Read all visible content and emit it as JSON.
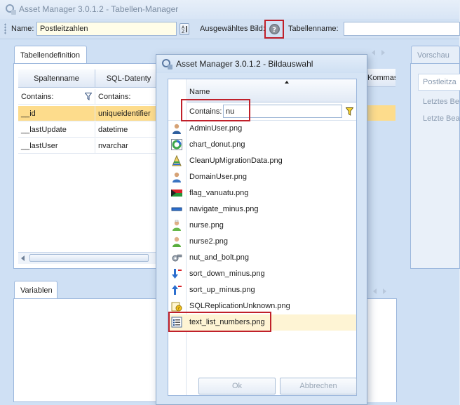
{
  "main": {
    "title": "Asset Manager 3.0.1.2 - Tabellen-Manager",
    "toolbar": {
      "name_label": "Name:",
      "name_value": "Postleitzahlen",
      "image_label": "Ausgewähltes Bild:",
      "tablename_label": "Tabellenname:",
      "tablename_value": ""
    },
    "table_def": {
      "tab": "Tabellendefinition",
      "columns": [
        "Spaltenname",
        "SQL-Datenty",
        "Kommas"
      ],
      "filter_label": "Contains:",
      "rows": [
        {
          "name": "__id",
          "type": "uniqueidentifier"
        },
        {
          "name": "__lastUpdate",
          "type": "datetime"
        },
        {
          "name": "__lastUser",
          "type": "nvarchar"
        }
      ]
    },
    "variables": {
      "tab": "Variablen"
    },
    "preview": {
      "tab": "Vorschau",
      "header": "Postleitza",
      "lines": [
        "Letztes Be",
        "Letzte Bea"
      ]
    }
  },
  "dialog": {
    "title": "Asset Manager 3.0.1.2 - Bildauswahl",
    "column": "Name",
    "filter_label": "Contains:",
    "filter_value": "nu",
    "files": [
      {
        "name": "AdminUser.png",
        "icon": "admin-user-icon"
      },
      {
        "name": "chart_donut.png",
        "icon": "chart-donut-icon"
      },
      {
        "name": "CleanUpMigrationData.png",
        "icon": "cleanup-icon"
      },
      {
        "name": "DomainUser.png",
        "icon": "domain-user-icon"
      },
      {
        "name": "flag_vanuatu.png",
        "icon": "flag-icon"
      },
      {
        "name": "navigate_minus.png",
        "icon": "navigate-minus-icon"
      },
      {
        "name": "nurse.png",
        "icon": "nurse-icon"
      },
      {
        "name": "nurse2.png",
        "icon": "nurse2-icon"
      },
      {
        "name": "nut_and_bolt.png",
        "icon": "nut-bolt-icon"
      },
      {
        "name": "sort_down_minus.png",
        "icon": "sort-down-minus-icon"
      },
      {
        "name": "sort_up_minus.png",
        "icon": "sort-up-minus-icon"
      },
      {
        "name": "SQLReplicationUnknown.png",
        "icon": "sql-replication-icon"
      },
      {
        "name": "text_list_numbers.png",
        "icon": "text-list-numbers-icon"
      }
    ],
    "selected_file": "text_list_numbers.png",
    "ok_label": "Ok",
    "cancel_label": "Abbrechen"
  },
  "colors": {
    "highlight": "#c0202a",
    "selected_row": "#fddc8c",
    "accent": "#9db8dd"
  }
}
